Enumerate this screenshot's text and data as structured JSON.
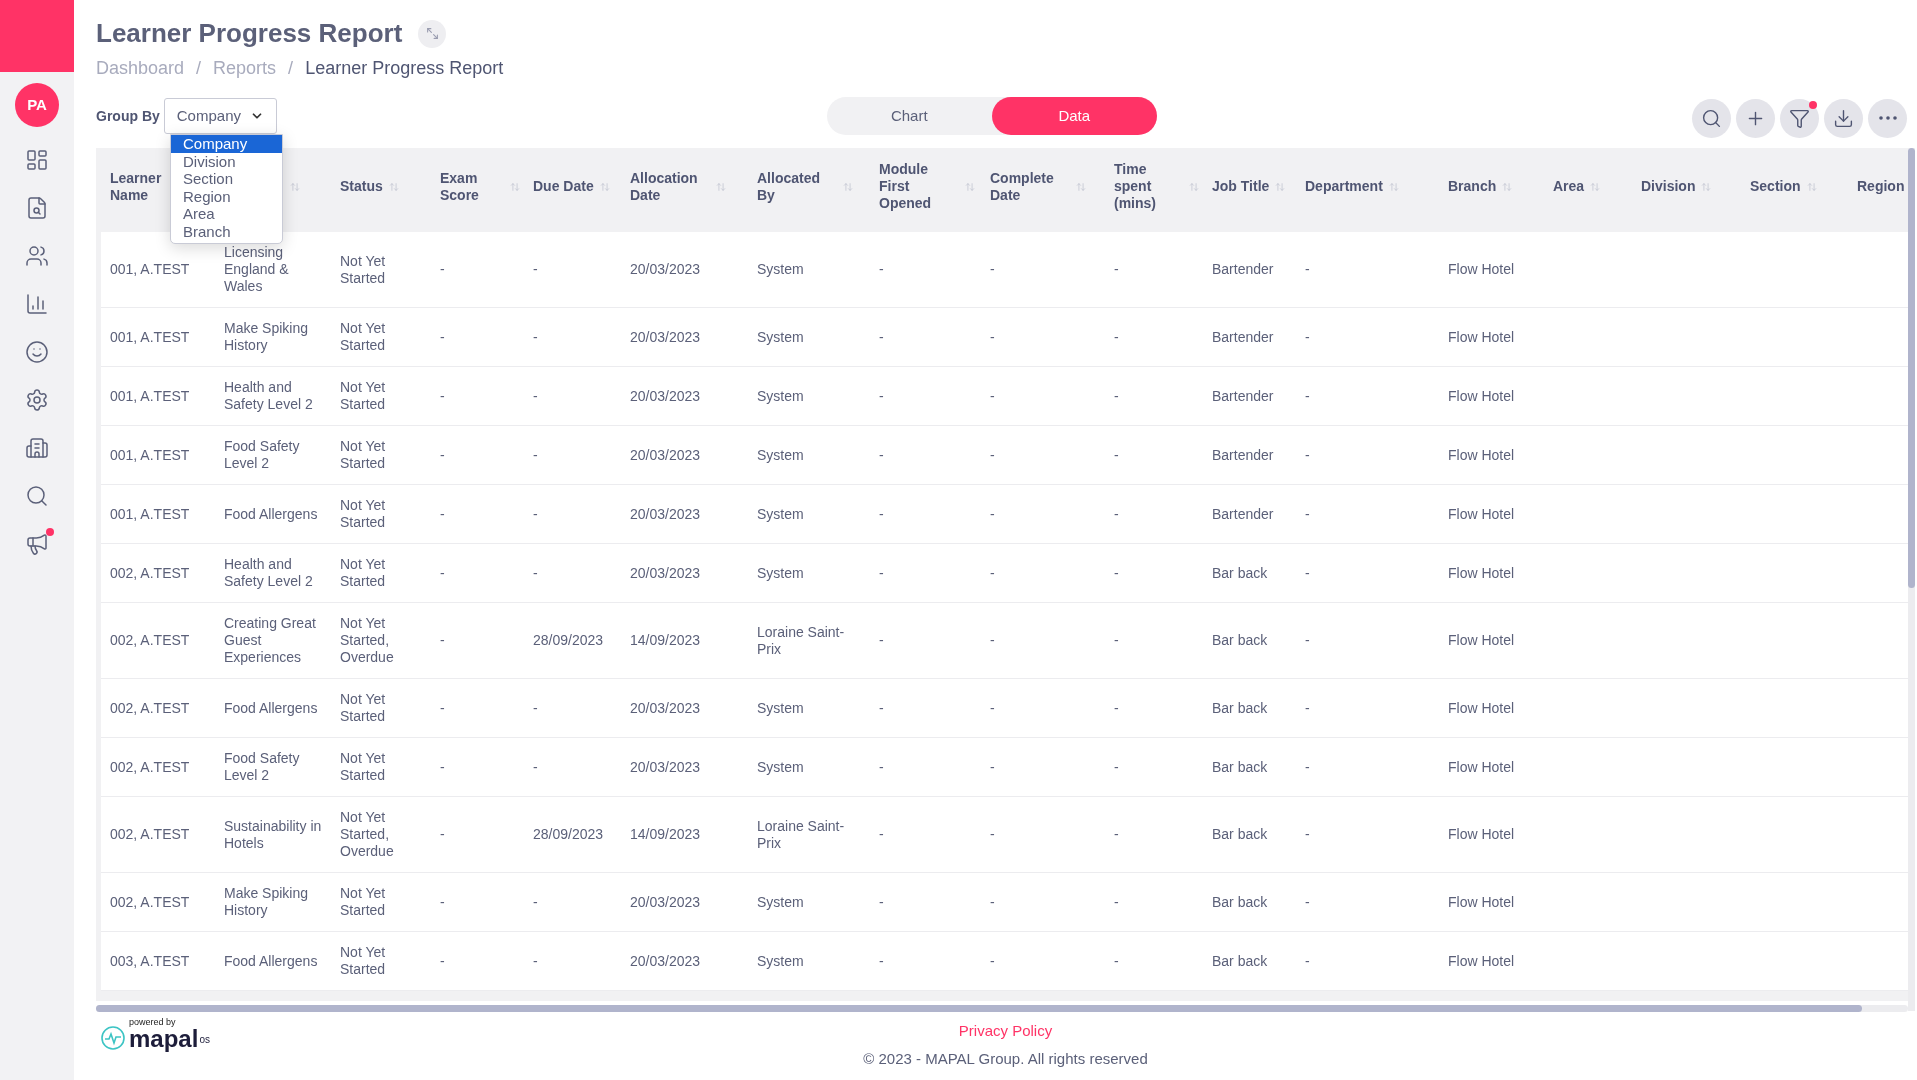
{
  "sidebar": {
    "avatar": "PA",
    "items": [
      {
        "badge": false
      },
      {
        "badge": false
      },
      {
        "badge": false
      },
      {
        "badge": false
      },
      {
        "badge": false
      },
      {
        "badge": false
      },
      {
        "badge": false
      },
      {
        "badge": false
      },
      {
        "badge": true
      }
    ]
  },
  "header": {
    "title": "Learner Progress Report",
    "breadcrumbs": [
      {
        "label": "Dashboard",
        "current": false
      },
      {
        "label": "Reports",
        "current": false
      },
      {
        "label": "Learner Progress Report",
        "current": true
      }
    ],
    "separator": "/"
  },
  "toolbar": {
    "group_by_label": "Group By",
    "group_by_value": "Company",
    "group_by_options": [
      {
        "label": "Company",
        "selected": true
      },
      {
        "label": "Division",
        "selected": false
      },
      {
        "label": "Section",
        "selected": false
      },
      {
        "label": "Region",
        "selected": false
      },
      {
        "label": "Area",
        "selected": false
      },
      {
        "label": "Branch",
        "selected": false
      }
    ],
    "view_toggle": [
      {
        "label": "Chart",
        "selected": false
      },
      {
        "label": "Data",
        "selected": true
      }
    ],
    "actions": [
      {
        "badge": false
      },
      {
        "badge": false
      },
      {
        "badge": true
      },
      {
        "badge": false
      },
      {
        "badge": false
      }
    ]
  },
  "table": {
    "columns": [
      {
        "kind": "text",
        "label": "Learner Name",
        "sortable": false
      },
      {
        "kind": "hidden",
        "sortable": true
      },
      {
        "kind": "text",
        "label": "Status",
        "sortable": true
      },
      {
        "kind": "text",
        "label": "Exam Score",
        "sortable": true
      },
      {
        "kind": "text",
        "label": "Due Date",
        "sortable": true
      },
      {
        "kind": "text",
        "label": "Allocation Date",
        "sortable": true
      },
      {
        "kind": "text",
        "label": "Allocated By",
        "sortable": true
      },
      {
        "kind": "text",
        "label": "Module First Opened",
        "sortable": true
      },
      {
        "kind": "text",
        "label": "Complete Date",
        "sortable": true
      },
      {
        "kind": "text",
        "label": "Time spent (mins)",
        "sortable": true
      },
      {
        "kind": "text",
        "label": "Job Title",
        "sortable": true
      },
      {
        "kind": "text",
        "label": "Department",
        "sortable": true
      },
      {
        "kind": "text",
        "label": "Branch",
        "sortable": true
      },
      {
        "kind": "text",
        "label": "Area",
        "sortable": true
      },
      {
        "kind": "text",
        "label": "Division",
        "sortable": true
      },
      {
        "kind": "text",
        "label": "Section",
        "sortable": true
      },
      {
        "kind": "text",
        "label": "Region",
        "sortable": false
      }
    ],
    "rows": [
      [
        "001, A.TEST",
        "Licensing England & Wales",
        "Not Yet Started",
        "-",
        "-",
        "20/03/2023",
        "System",
        "-",
        "-",
        "-",
        "Bartender",
        "-",
        "Flow Hotel"
      ],
      [
        "001, A.TEST",
        "Make Spiking History",
        "Not Yet Started",
        "-",
        "-",
        "20/03/2023",
        "System",
        "-",
        "-",
        "-",
        "Bartender",
        "-",
        "Flow Hotel"
      ],
      [
        "001, A.TEST",
        "Health and Safety Level 2",
        "Not Yet Started",
        "-",
        "-",
        "20/03/2023",
        "System",
        "-",
        "-",
        "-",
        "Bartender",
        "-",
        "Flow Hotel"
      ],
      [
        "001, A.TEST",
        "Food Safety Level 2",
        "Not Yet Started",
        "-",
        "-",
        "20/03/2023",
        "System",
        "-",
        "-",
        "-",
        "Bartender",
        "-",
        "Flow Hotel"
      ],
      [
        "001, A.TEST",
        "Food Allergens",
        "Not Yet Started",
        "-",
        "-",
        "20/03/2023",
        "System",
        "-",
        "-",
        "-",
        "Bartender",
        "-",
        "Flow Hotel"
      ],
      [
        "002, A.TEST",
        "Health and Safety Level 2",
        "Not Yet Started",
        "-",
        "-",
        "20/03/2023",
        "System",
        "-",
        "-",
        "-",
        "Bar back",
        "-",
        "Flow Hotel"
      ],
      [
        "002, A.TEST",
        "Creating Great Guest Experiences",
        "Not Yet Started, Overdue",
        "-",
        "28/09/2023",
        "14/09/2023",
        "Loraine Saint-Prix",
        "-",
        "-",
        "-",
        "Bar back",
        "-",
        "Flow Hotel"
      ],
      [
        "002, A.TEST",
        "Food Allergens",
        "Not Yet Started",
        "-",
        "-",
        "20/03/2023",
        "System",
        "-",
        "-",
        "-",
        "Bar back",
        "-",
        "Flow Hotel"
      ],
      [
        "002, A.TEST",
        "Food Safety Level 2",
        "Not Yet Started",
        "-",
        "-",
        "20/03/2023",
        "System",
        "-",
        "-",
        "-",
        "Bar back",
        "-",
        "Flow Hotel"
      ],
      [
        "002, A.TEST",
        "Sustainability in Hotels",
        "Not Yet Started, Overdue",
        "-",
        "28/09/2023",
        "14/09/2023",
        "Loraine Saint-Prix",
        "-",
        "-",
        "-",
        "Bar back",
        "-",
        "Flow Hotel"
      ],
      [
        "002, A.TEST",
        "Make Spiking History",
        "Not Yet Started",
        "-",
        "-",
        "20/03/2023",
        "System",
        "-",
        "-",
        "-",
        "Bar back",
        "-",
        "Flow Hotel"
      ],
      [
        "003, A.TEST",
        "Food Allergens",
        "Not Yet Started",
        "-",
        "-",
        "20/03/2023",
        "System",
        "-",
        "-",
        "-",
        "Bar back",
        "-",
        "Flow Hotel"
      ]
    ]
  },
  "footer": {
    "powered_by": "powered by",
    "logo": "mapal",
    "logo_suffix": "os",
    "privacy_link": "Privacy Policy",
    "copyright": "© 2023 - MAPAL Group. All rights reserved"
  }
}
